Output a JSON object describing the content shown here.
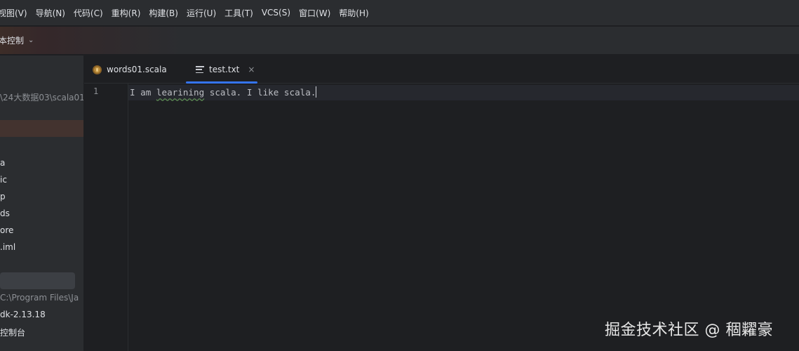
{
  "menu": {
    "items": [
      "视图(V)",
      "导航(N)",
      "代码(C)",
      "重构(R)",
      "构建(B)",
      "运行(U)",
      "工具(T)",
      "VCS(S)",
      "窗口(W)",
      "帮助(H)"
    ]
  },
  "toolbar": {
    "vcs_label": "本控制"
  },
  "sidebar": {
    "project_path": "\\24大数据03\\scala01",
    "files": [
      "a",
      "ic",
      "p",
      "ds",
      "ore",
      ".iml"
    ],
    "jdk_path": "C:\\Program Files\\Ja",
    "sdk_label": "dk-2.13.18",
    "console_label": "控制台"
  },
  "tabs": [
    {
      "label": "words01.scala",
      "icon": "scala-file-icon"
    },
    {
      "label": "test.txt",
      "icon": "text-file-icon",
      "active": true,
      "close": "×"
    }
  ],
  "editor": {
    "line_number": "1",
    "text_pre": "I am ",
    "text_squiggle": "learining",
    "text_post": " scala. I like scala."
  },
  "watermark": "掘金技术社区 @ 稒糶豪",
  "colors": {
    "background": "#1e1f22",
    "panel": "#2b2d30",
    "accent": "#3574f0",
    "text": "#dfe1e5"
  }
}
